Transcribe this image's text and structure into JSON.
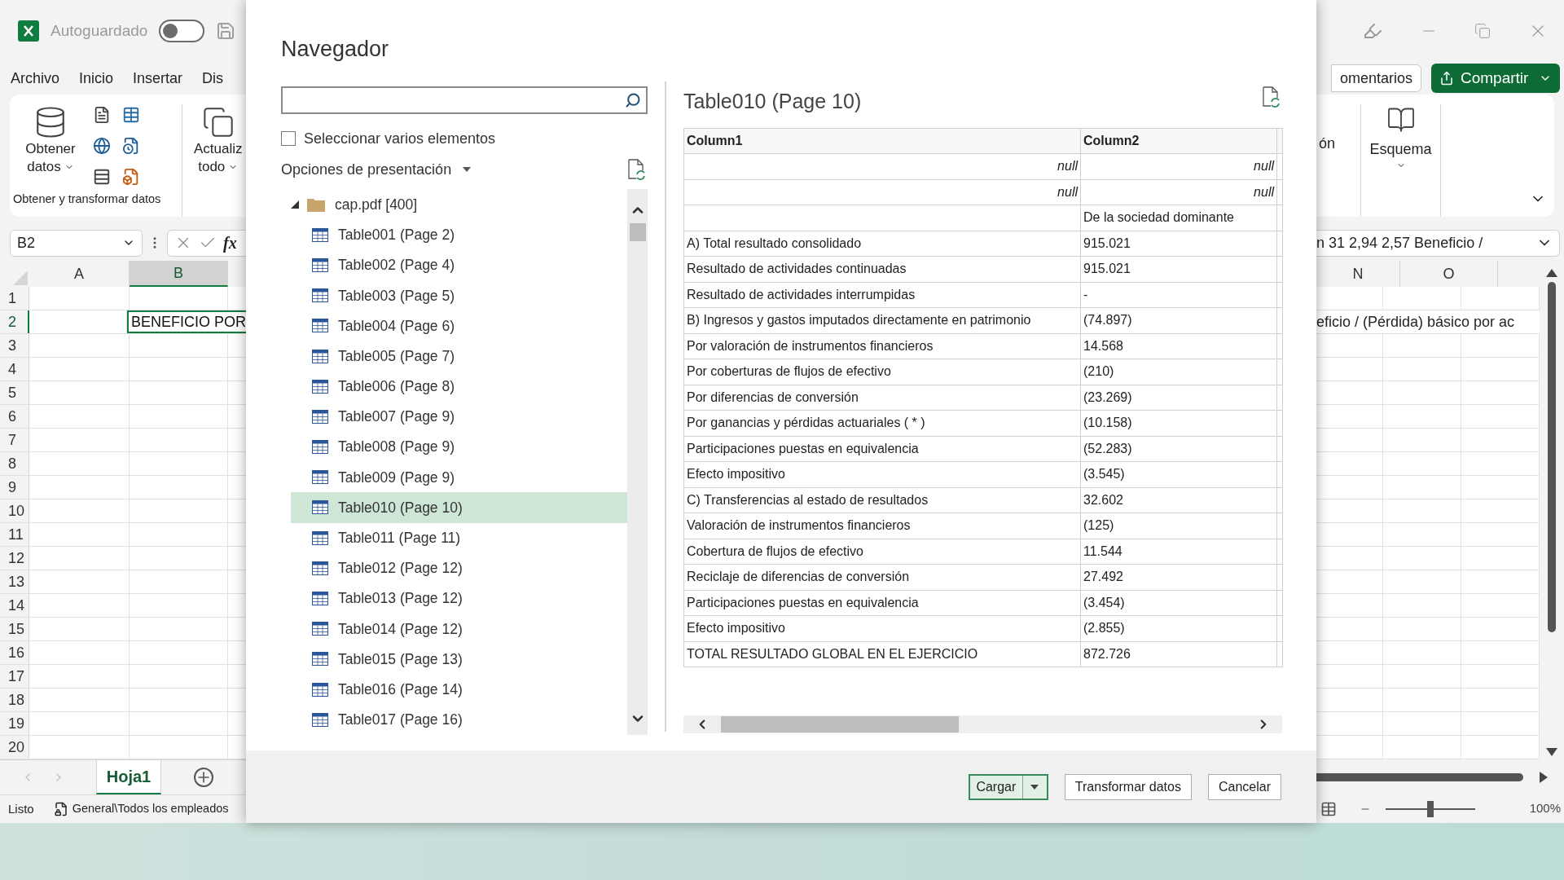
{
  "excel": {
    "title_bar": {
      "autosave_label": "Autoguardado",
      "autosave_on": false
    },
    "menu_tabs": [
      "Archivo",
      "Inicio",
      "Insertar",
      "Dis"
    ],
    "ribbon_left": {
      "get_data_lines": [
        "Obtener",
        "datos"
      ],
      "refresh_lines": [
        "Actualiz",
        "todo"
      ],
      "group_label": "Obtener y transformar datos"
    },
    "ribbon_right": {
      "partial_label": "ón",
      "outline_label": "Esquema"
    },
    "comments_button": "omentarios",
    "share_button": "Compartir",
    "name_box": "B2",
    "function_button": "fx",
    "formula_text": "n 31 2,94 2,57 Beneficio /",
    "left_columns": [
      {
        "label": "A",
        "selected": false
      },
      {
        "label": "B",
        "selected": true
      }
    ],
    "right_columns": [
      {
        "label": "N",
        "selected": false
      },
      {
        "label": "O",
        "selected": false
      }
    ],
    "rows": [
      {
        "label": "1",
        "selected": false
      },
      {
        "label": "2",
        "selected": true
      },
      {
        "label": "3",
        "selected": false
      },
      {
        "label": "4",
        "selected": false
      },
      {
        "label": "5",
        "selected": false
      },
      {
        "label": "6",
        "selected": false
      },
      {
        "label": "7",
        "selected": false
      },
      {
        "label": "8",
        "selected": false
      },
      {
        "label": "9",
        "selected": false
      },
      {
        "label": "10",
        "selected": false
      },
      {
        "label": "11",
        "selected": false
      },
      {
        "label": "12",
        "selected": false
      },
      {
        "label": "13",
        "selected": false
      },
      {
        "label": "14",
        "selected": false
      },
      {
        "label": "15",
        "selected": false
      },
      {
        "label": "16",
        "selected": false
      },
      {
        "label": "17",
        "selected": false
      },
      {
        "label": "18",
        "selected": false
      },
      {
        "label": "19",
        "selected": false
      },
      {
        "label": "20",
        "selected": false
      }
    ],
    "cell_b2": "BENEFICIO POR",
    "cell_n2": "eficio / (Pérdida) básico por ac",
    "sheet_tabs": [
      {
        "label": "Hoja1",
        "selected": true
      }
    ],
    "status": {
      "ready": "Listo",
      "location": "General\\Todos los empleados"
    },
    "zoom": {
      "level": 0.5,
      "reading": "100%"
    }
  },
  "dialog": {
    "title": "Navegador",
    "multi_select": {
      "label": "Seleccionar varios elementos",
      "checked": false
    },
    "display_options": "Opciones de presentación",
    "tree": {
      "label": "cap.pdf [400]",
      "expanded": true,
      "children": [
        {
          "label": "Table001 (Page 2)",
          "selected": false
        },
        {
          "label": "Table002 (Page 4)",
          "selected": false
        },
        {
          "label": "Table003 (Page 5)",
          "selected": false
        },
        {
          "label": "Table004 (Page 6)",
          "selected": false
        },
        {
          "label": "Table005 (Page 7)",
          "selected": false
        },
        {
          "label": "Table006 (Page 8)",
          "selected": false
        },
        {
          "label": "Table007 (Page 9)",
          "selected": false
        },
        {
          "label": "Table008 (Page 9)",
          "selected": false
        },
        {
          "label": "Table009 (Page 9)",
          "selected": false
        },
        {
          "label": "Table010 (Page 10)",
          "selected": true
        },
        {
          "label": "Table011 (Page 11)",
          "selected": false
        },
        {
          "label": "Table012 (Page 12)",
          "selected": false
        },
        {
          "label": "Table013 (Page 12)",
          "selected": false
        },
        {
          "label": "Table014 (Page 12)",
          "selected": false
        },
        {
          "label": "Table015 (Page 13)",
          "selected": false
        },
        {
          "label": "Table016 (Page 14)",
          "selected": false
        },
        {
          "label": "Table017 (Page 16)",
          "selected": false
        }
      ]
    },
    "preview": {
      "title": "Table010 (Page 10)",
      "columns": [
        "Column1",
        "Column2"
      ],
      "rows": [
        {
          "kind": "null",
          "column1": "null",
          "column2": "null"
        },
        {
          "kind": "null",
          "column1": "null",
          "column2": "null"
        },
        {
          "kind": "text",
          "column2": "De la sociedad dominante"
        },
        {
          "kind": "text",
          "column1": "A) Total resultado consolidado",
          "column2": "915.021"
        },
        {
          "kind": "text",
          "column1": "Resultado de actividades continuadas",
          "column2": "915.021"
        },
        {
          "kind": "text",
          "column1": "Resultado de actividades interrumpidas",
          "column2": "-"
        },
        {
          "kind": "text",
          "column1": "B) Ingresos y gastos imputados directamente en patrimonio",
          "column2": "(74.897)"
        },
        {
          "kind": "text",
          "column1": "Por valoración de instrumentos financieros",
          "column2": "14.568"
        },
        {
          "kind": "text",
          "column1": "Por coberturas de flujos de efectivo",
          "column2": "(210)"
        },
        {
          "kind": "text",
          "column1": "Por diferencias de conversión",
          "column2": "(23.269)"
        },
        {
          "kind": "text",
          "column1": "Por ganancias y pérdidas actuariales ( * )",
          "column2": "(10.158)"
        },
        {
          "kind": "text",
          "column1": "Participaciones puestas en equivalencia",
          "column2": "(52.283)"
        },
        {
          "kind": "text",
          "column1": "Efecto impositivo",
          "column2": "(3.545)"
        },
        {
          "kind": "text",
          "column1": "C) Transferencias al estado de resultados",
          "column2": "32.602"
        },
        {
          "kind": "text",
          "column1": "Valoración de instrumentos financieros",
          "column2": "(125)"
        },
        {
          "kind": "text",
          "column1": "Cobertura de flujos de efectivo",
          "column2": "11.544"
        },
        {
          "kind": "text",
          "column1": "Reciclaje de diferencias de conversión",
          "column2": "27.492"
        },
        {
          "kind": "text",
          "column1": "Participaciones puestas en equivalencia",
          "column2": "(3.454)"
        },
        {
          "kind": "text",
          "column1": "Efecto impositivo",
          "column2": "(2.855)"
        },
        {
          "kind": "text",
          "column1": "TOTAL RESULTADO GLOBAL EN EL EJERCICIO",
          "column2": "872.726"
        }
      ]
    },
    "buttons": [
      {
        "label": "Cargar",
        "kind": "split"
      },
      {
        "label": "Transformar datos",
        "kind": "plain"
      },
      {
        "label": "Cancelar",
        "kind": "plain"
      }
    ]
  }
}
